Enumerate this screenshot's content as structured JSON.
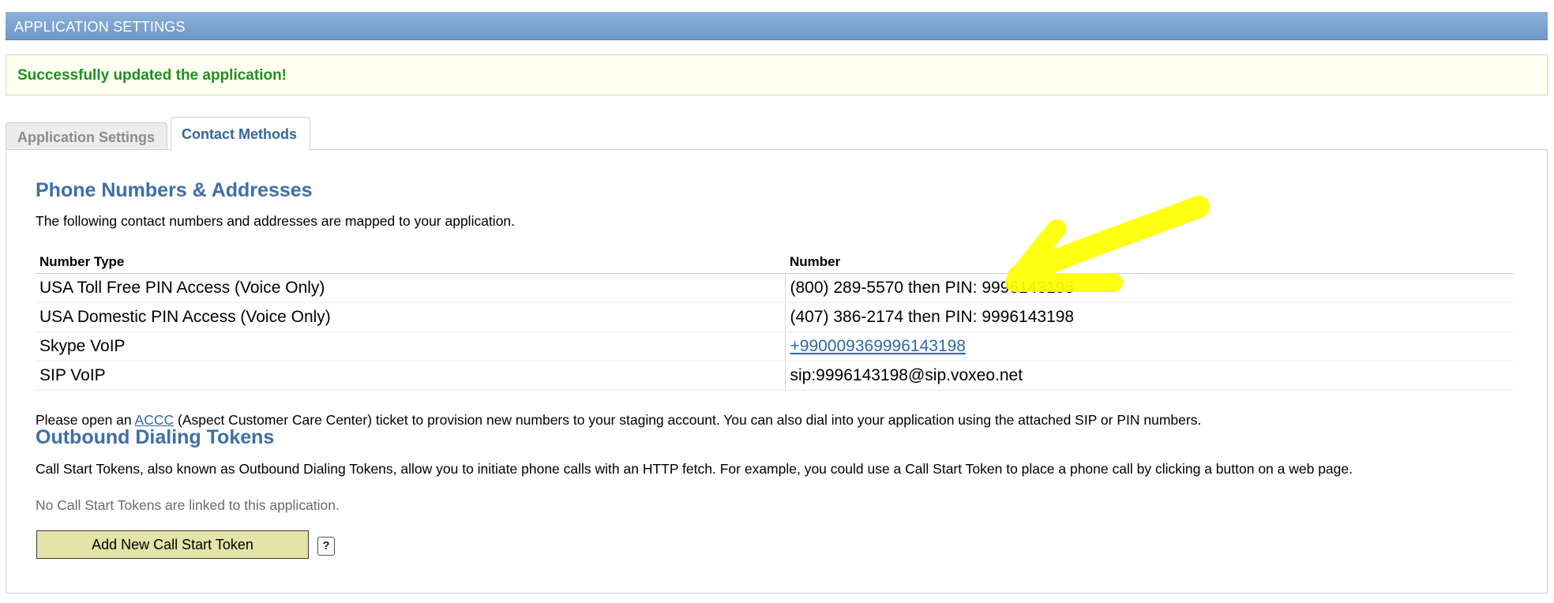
{
  "header": {
    "title": "APPLICATION SETTINGS"
  },
  "notice": {
    "message": "Successfully updated the application!"
  },
  "tabs": [
    {
      "label": "Application Settings",
      "active": false
    },
    {
      "label": "Contact Methods",
      "active": true
    }
  ],
  "phone_section": {
    "title": "Phone Numbers & Addresses",
    "description": "The following contact numbers and addresses are mapped to your application.",
    "columns": [
      "Number Type",
      "Number"
    ],
    "rows": [
      {
        "type": "USA Toll Free PIN Access (Voice Only)",
        "number": "(800) 289-5570 then PIN: 9996143198"
      },
      {
        "type": "USA Domestic PIN Access (Voice Only)",
        "number": "(407) 386-2174 then PIN: 9996143198"
      },
      {
        "type": "Skype VoIP",
        "number": "+990009369996143198"
      },
      {
        "type": "SIP VoIP",
        "number": "sip:9996143198@sip.voxeo.net"
      }
    ],
    "note_prefix": "Please open an ",
    "note_link": "ACCC",
    "note_suffix": " (Aspect Customer Care Center) ticket to provision new numbers to your staging account. You can also dial into your application using the attached SIP or PIN numbers."
  },
  "tokens_section": {
    "title": "Outbound Dialing Tokens",
    "description": "Call Start Tokens, also known as Outbound Dialing Tokens, allow you to initiate phone calls with an HTTP fetch. For example, you could use a Call Start Token to place a phone call by clicking a button on a web page.",
    "empty_message": "No Call Start Tokens are linked to this application.",
    "add_button": "Add New Call Start Token",
    "help_label": "?"
  },
  "colors": {
    "header_bg": "#7aa1d0",
    "success_text": "#1f8f1f",
    "section_title": "#3d6fa6",
    "link": "#2c67a8",
    "button_bg": "#e4e3a9",
    "highlight": "#ffff00"
  }
}
